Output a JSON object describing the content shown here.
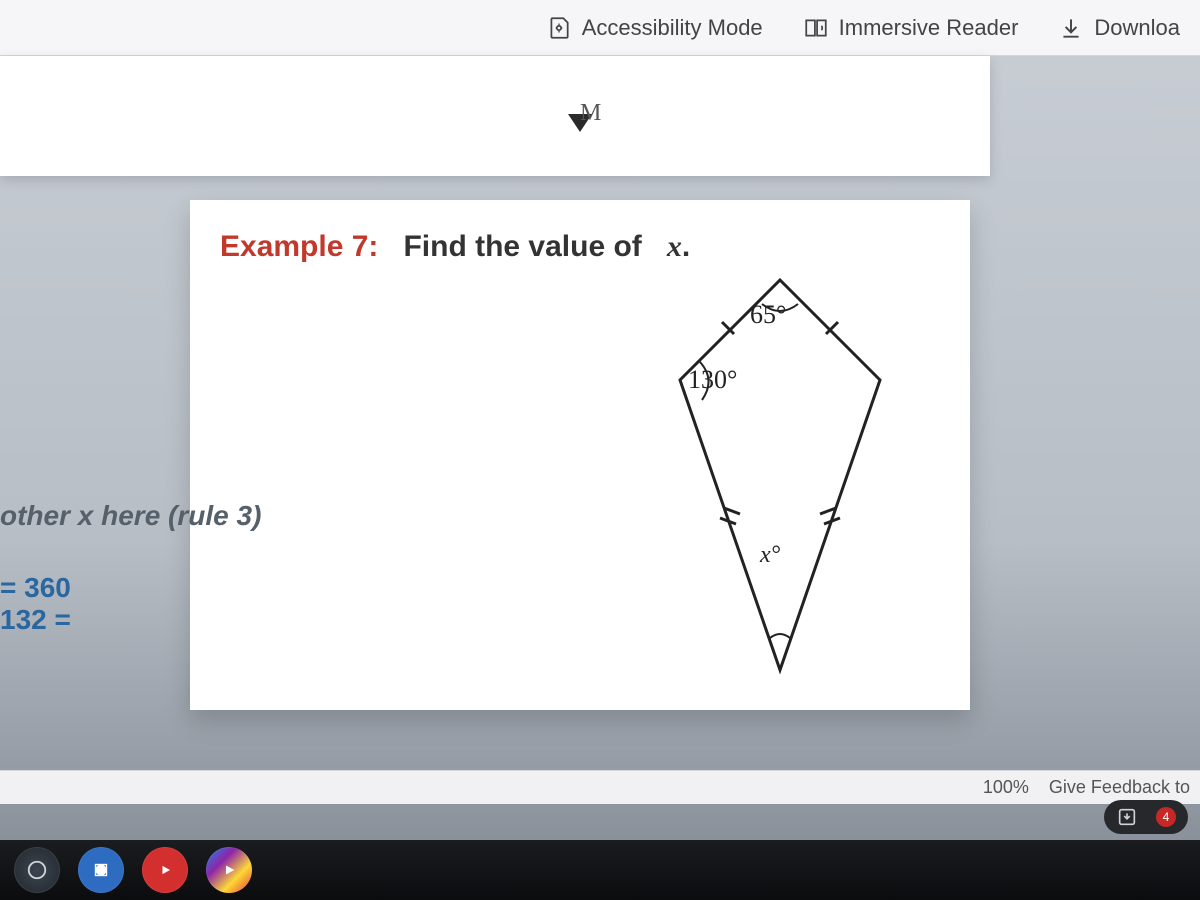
{
  "toolbar": {
    "accessibility": "Accessibility Mode",
    "immersive": "Immersive Reader",
    "download": "Downloa"
  },
  "page_marker": "M",
  "example": {
    "label": "Example 7:",
    "prompt": "Find the value of",
    "variable": "x",
    "period": "."
  },
  "kite": {
    "angle_top": "65°",
    "angle_left": "130°",
    "angle_bottom": "x°"
  },
  "notes": {
    "rule": "other x here (rule 3)",
    "line1": "= 360",
    "line2": "132 ="
  },
  "statusbar": {
    "zoom": "100%",
    "feedback": "Give Feedback to"
  },
  "tray": {
    "badge_count": "4"
  }
}
